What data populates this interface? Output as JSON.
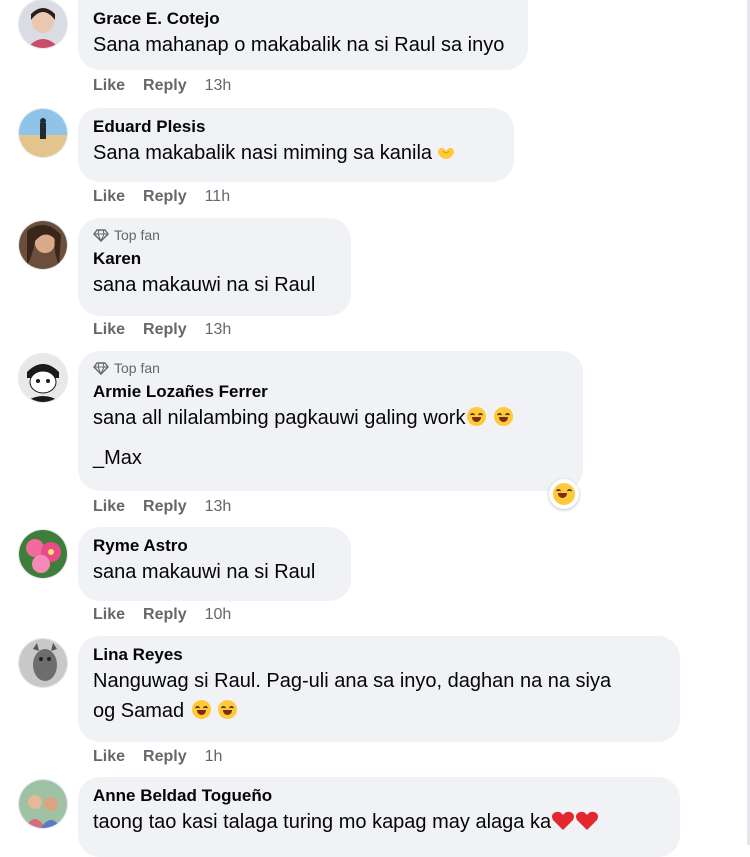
{
  "comments": [
    {
      "name": "Grace E. Cotejo",
      "text": "Sana mahanap o makabalik na si Raul sa inyo",
      "like": "Like",
      "reply": "Reply",
      "time": "13h"
    },
    {
      "name": "Eduard Plesis",
      "text": "Sana makabalik nasi miming sa kanila",
      "like": "Like",
      "reply": "Reply",
      "time": "11h"
    },
    {
      "badge": "Top fan",
      "name": "Karen",
      "text": "sana makauwi na si Raul",
      "like": "Like",
      "reply": "Reply",
      "time": "13h"
    },
    {
      "badge": "Top fan",
      "name": "Armie Lozañes Ferrer",
      "text": "sana all nilalambing pagkauwi galing work",
      "text2": "_Max",
      "like": "Like",
      "reply": "Reply",
      "time": "13h"
    },
    {
      "name": "Ryme Astro",
      "text": "sana makauwi na si Raul",
      "like": "Like",
      "reply": "Reply",
      "time": "10h"
    },
    {
      "name": "Lina Reyes",
      "text": "Nanguwag si Raul. Pag-uli ana sa inyo, daghan na na siya",
      "text2": "og Samad",
      "like": "Like",
      "reply": "Reply",
      "time": "1h"
    },
    {
      "name": "Anne Beldad Togueño",
      "text": "taong tao kasi talaga turing mo kapag may alaga ka"
    }
  ],
  "colors": {
    "bubble": "#f0f2f5",
    "meta": "#65676b",
    "heart": "#e4262e",
    "emoji": "#ffc93a"
  }
}
